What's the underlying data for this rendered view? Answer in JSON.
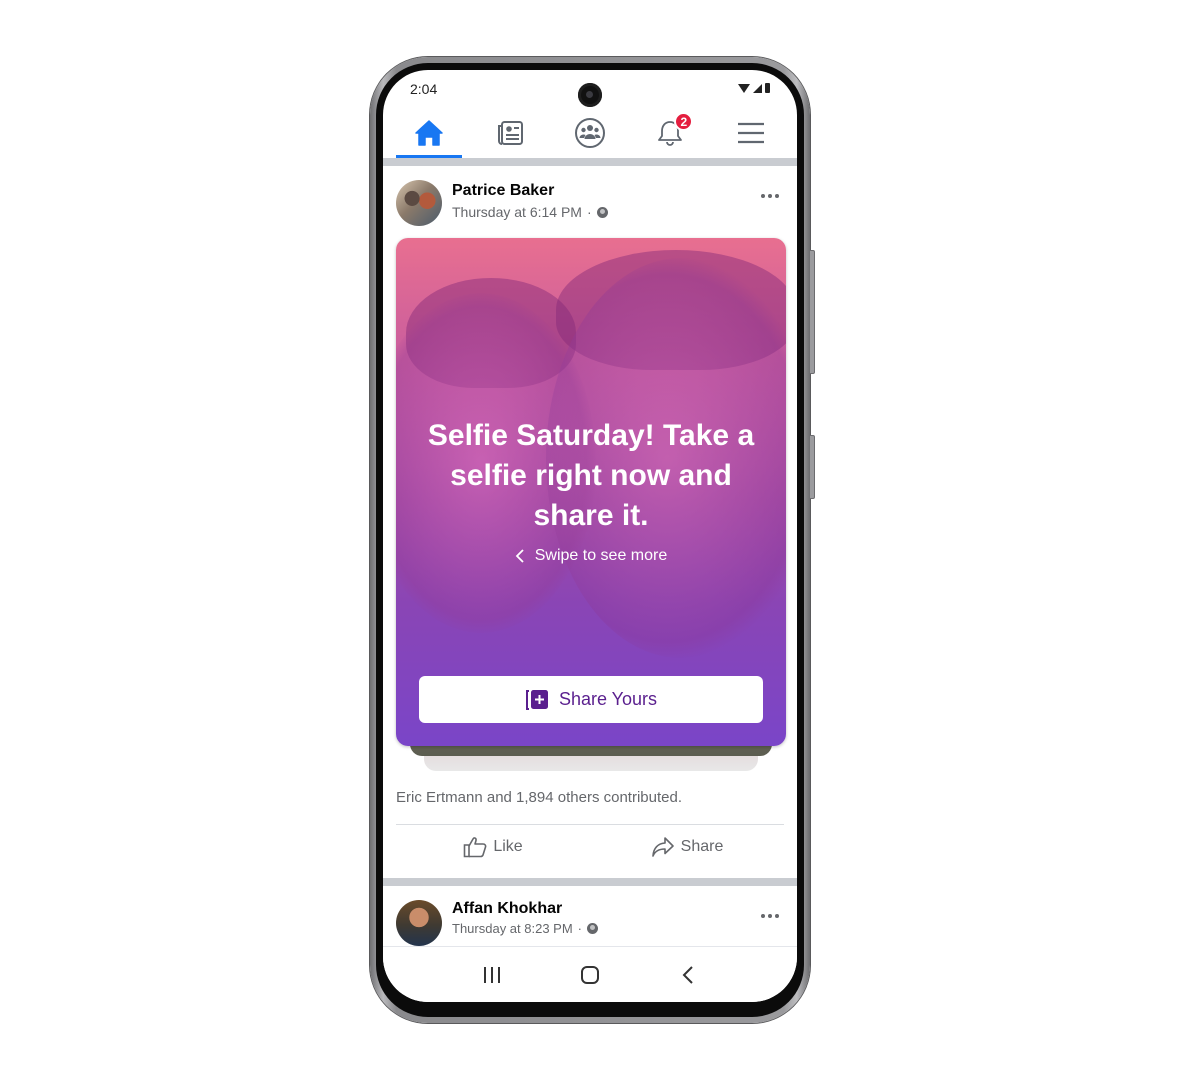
{
  "status_bar": {
    "time": "2:04",
    "icons": [
      "wifi-icon",
      "signal-icon",
      "battery-icon"
    ]
  },
  "nav": {
    "tabs": [
      {
        "name": "home",
        "icon": "home-icon",
        "active": true
      },
      {
        "name": "news",
        "icon": "news-feed-icon",
        "active": false
      },
      {
        "name": "groups",
        "icon": "groups-icon",
        "active": false
      },
      {
        "name": "notifications",
        "icon": "bell-icon",
        "active": false,
        "badge": "2"
      },
      {
        "name": "menu",
        "icon": "hamburger-menu-icon",
        "active": false
      }
    ],
    "accent_color": "#1877f2",
    "badge_color": "#e41e3f"
  },
  "post1": {
    "author": "Patrice Baker",
    "timestamp": "Thursday at 6:14 PM",
    "separator": "·",
    "privacy_icon": "globe-icon",
    "card": {
      "title": "Selfie Saturday! Take a selfie right now and share it.",
      "swipe_hint": "Swipe to see more",
      "share_button": "Share Yours",
      "button_text_color": "#5a1f8e"
    },
    "contributions": "Eric Ertmann and 1,894 others contributed.",
    "actions": {
      "like": "Like",
      "share": "Share"
    }
  },
  "post2": {
    "author": "Affan Khokhar",
    "timestamp": "Thursday at 8:23 PM",
    "separator": "·",
    "privacy_icon": "globe-icon"
  },
  "system_nav": {
    "buttons": [
      "recents-icon",
      "home-button-icon",
      "back-icon"
    ]
  }
}
